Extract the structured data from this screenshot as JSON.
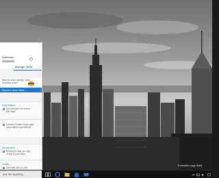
{
  "cortana": {
    "header_title": "Notebook",
    "tab_label": "Manage Skills",
    "intro_lines": [
      "Want to track movies, order",
      "food and more?",
      "Discover more Skills"
    ],
    "cta_label": "Discover more Skills",
    "cards": [
      {
        "title": "Reminders",
        "line1": "Set reminders for events",
        "line2": "and tasks",
        "icon": "calendar-icon"
      },
      {
        "title": "Connected",
        "line1": "Connect Cortana to get more",
        "line2": "personalized experiences",
        "icon": "link-icon"
      },
      {
        "title": "Reminders",
        "line1": "Reminders help you stay",
        "line2": "on top of your tasks",
        "icon": "bell-icon"
      },
      {
        "title": "Traffic",
        "line1": "Get traffic info for your",
        "line2": "commute",
        "icon": "car-icon"
      }
    ]
  },
  "taskbar": {
    "search_placeholder": "Ask me anything",
    "clock_time": "",
    "clock_date": "",
    "apps": [
      "task-view-icon",
      "edge-icon",
      "file-explorer-icon",
      "store-icon",
      "mail-icon"
    ]
  },
  "desktop": {
    "watermark": "Evaluation copy. Build"
  },
  "colors": {
    "accent": "#1e78c8",
    "taskbar": "#101010",
    "panel": "#f2f2f2"
  }
}
